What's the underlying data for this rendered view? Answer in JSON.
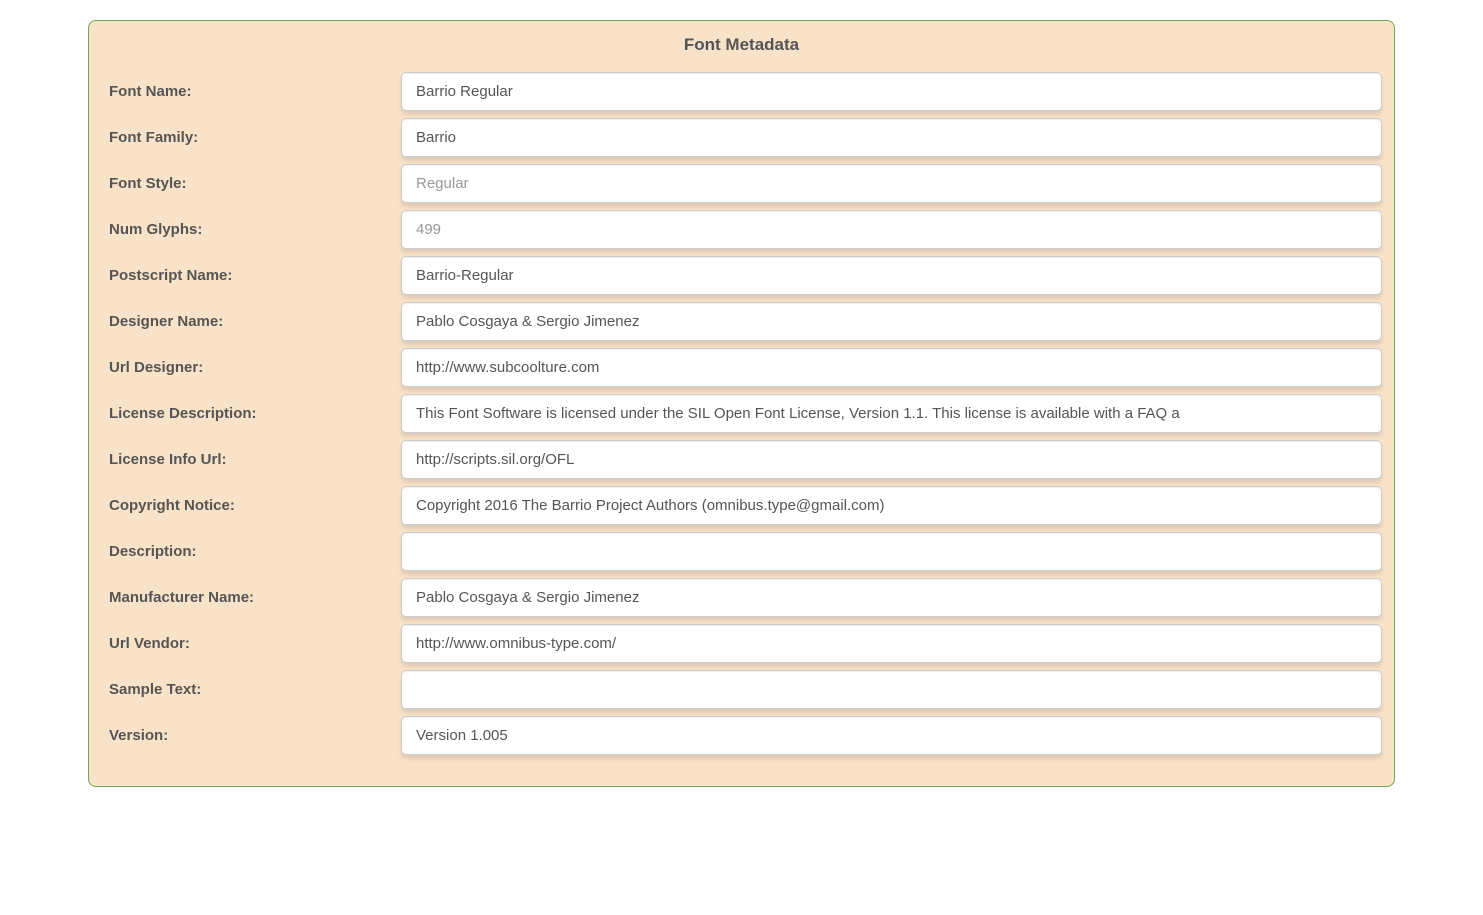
{
  "panel": {
    "title": "Font Metadata",
    "fields": {
      "font_name": {
        "label": "Font Name:",
        "value": "Barrio Regular",
        "readonly": false
      },
      "font_family": {
        "label": "Font Family:",
        "value": "Barrio",
        "readonly": false
      },
      "font_style": {
        "label": "Font Style:",
        "value": "Regular",
        "readonly": true
      },
      "num_glyphs": {
        "label": "Num Glyphs:",
        "value": "499",
        "readonly": true
      },
      "postscript_name": {
        "label": "Postscript Name:",
        "value": "Barrio-Regular",
        "readonly": false
      },
      "designer_name": {
        "label": "Designer Name:",
        "value": "Pablo Cosgaya & Sergio Jimenez",
        "readonly": false
      },
      "url_designer": {
        "label": "Url Designer:",
        "value": "http://www.subcoolture.com",
        "readonly": false
      },
      "license_description": {
        "label": "License Description:",
        "value": "This Font Software is licensed under the SIL Open Font License, Version 1.1. This license is available with a FAQ a",
        "readonly": false
      },
      "license_info_url": {
        "label": "License Info Url:",
        "value": "http://scripts.sil.org/OFL",
        "readonly": false
      },
      "copyright_notice": {
        "label": "Copyright Notice:",
        "value": "Copyright 2016 The Barrio Project Authors (omnibus.type@gmail.com)",
        "readonly": false
      },
      "description": {
        "label": "Description:",
        "value": "",
        "readonly": false
      },
      "manufacturer_name": {
        "label": "Manufacturer Name:",
        "value": "Pablo Cosgaya & Sergio Jimenez",
        "readonly": false
      },
      "url_vendor": {
        "label": "Url Vendor:",
        "value": "http://www.omnibus-type.com/",
        "readonly": false
      },
      "sample_text": {
        "label": "Sample Text:",
        "value": "",
        "readonly": false
      },
      "version": {
        "label": "Version:",
        "value": "Version 1.005",
        "readonly": false
      }
    }
  }
}
